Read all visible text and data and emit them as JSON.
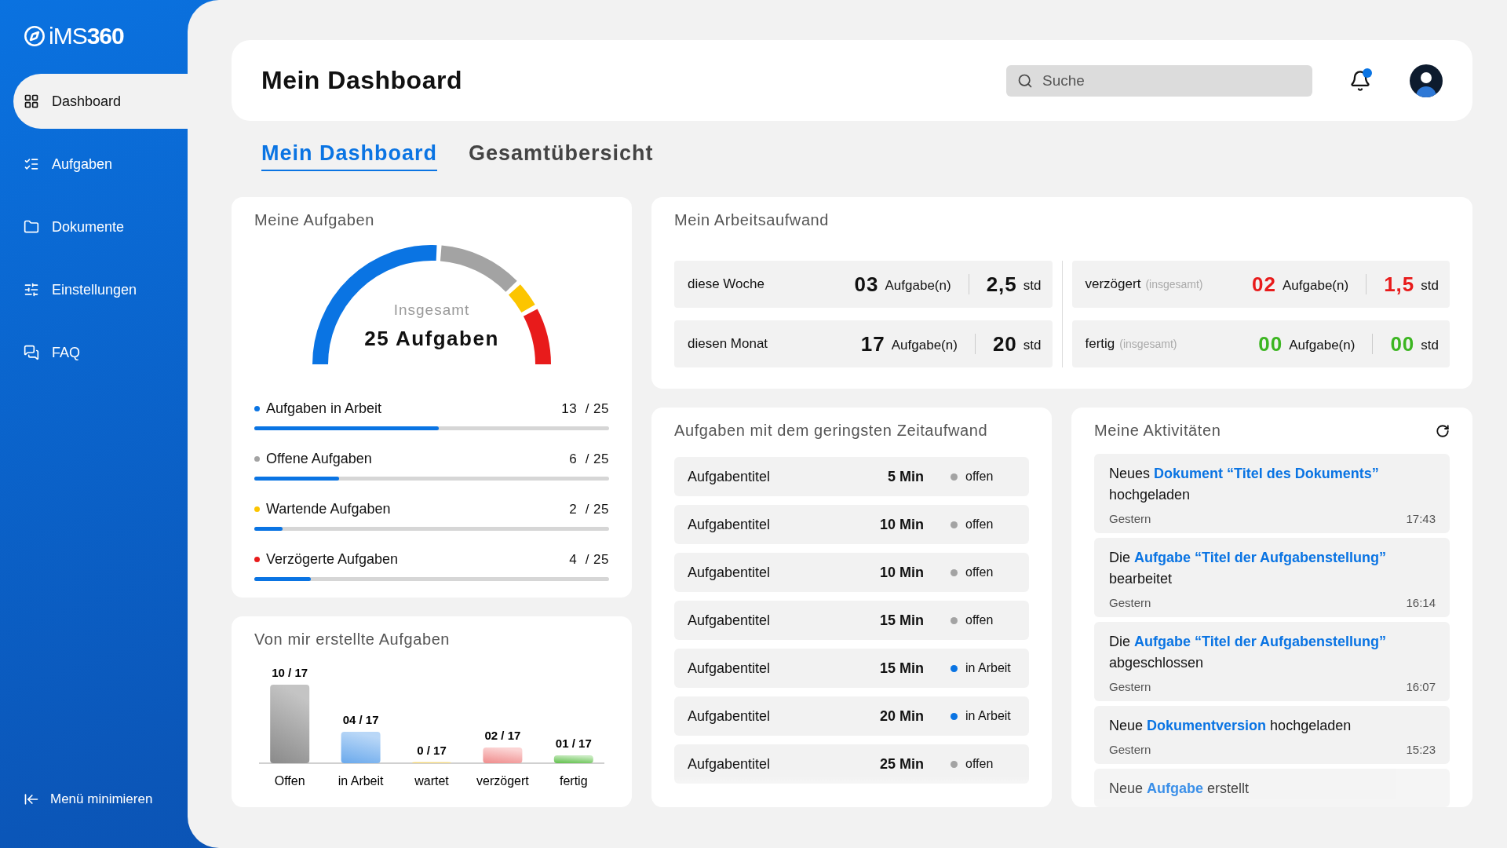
{
  "sidebar": {
    "logo": "iMS**360**",
    "items": [
      {
        "label": "Dashboard",
        "selected": true
      },
      {
        "label": "Aufgaben",
        "selected": false
      },
      {
        "label": "Dokumente",
        "selected": false
      },
      {
        "label": "Einstellungen",
        "selected": false
      },
      {
        "label": "FAQ",
        "selected": false
      }
    ],
    "collapse": "Menü minimieren"
  },
  "header": {
    "title": "Mein Dashboard",
    "search": {
      "placeholder": "Suche"
    },
    "notifications": {
      "unread": true
    }
  },
  "tabs": [
    {
      "label": "Mein Dashboard",
      "selected": true
    },
    {
      "label": "Gesamtübersicht",
      "selected": false
    }
  ],
  "my_tasks": {
    "title": "Meine Aufgaben",
    "gauge_caption": "Insgesamt",
    "gauge_total": "25 Aufgaben",
    "items": [
      {
        "label": "Aufgaben in Arbeit",
        "count": "13",
        "total": "/ 25",
        "color": "#0a74e3",
        "level": 0.52
      },
      {
        "label": "Offene Aufgaben",
        "count": "6",
        "total": "/ 25",
        "color": "#a3a3a3",
        "level": 0.24
      },
      {
        "label": "Wartende Aufgaben",
        "count": "2",
        "total": "/ 25",
        "color": "#fcc500",
        "level": 0.08
      },
      {
        "label": "Verzögerte Aufgaben",
        "count": "4",
        "total": "/ 25",
        "color": "#e81b1b",
        "level": 0.16
      }
    ]
  },
  "workload": {
    "title": "Mein Arbeitsaufwand",
    "columns": [
      [
        {
          "label": "diese Woche",
          "count": "03",
          "count_unit": "Aufgabe(n)",
          "hours": "2,5",
          "hours_unit": "std",
          "color": "#111111"
        },
        {
          "label": "diesen Monat",
          "count": "17",
          "count_unit": "Aufgabe(n)",
          "hours": "20",
          "hours_unit": "std",
          "color": "#111111"
        }
      ],
      [
        {
          "label": "verzögert",
          "note": "(insgesamt)",
          "count": "02",
          "count_unit": "Aufgabe(n)",
          "hours": "1,5",
          "hours_unit": "std",
          "color": "#e81b1b"
        },
        {
          "label": "fertig",
          "note": "(insgesamt)",
          "count": "00",
          "count_unit": "Aufgabe(n)",
          "hours": "00",
          "hours_unit": "std",
          "color": "#3cb521"
        }
      ]
    ]
  },
  "created_tasks": {
    "title": "Von mir erstellte Aufgaben",
    "chart_data": {
      "type": "bar",
      "categories": [
        "Offen",
        "in Arbeit",
        "wartet",
        "verzögert",
        "fertig"
      ],
      "values": [
        10,
        4,
        0,
        2,
        1
      ],
      "value_labels": [
        "10 / 17",
        "04 / 17",
        "0 / 17",
        "02 / 17",
        "01 / 17"
      ]
    }
  },
  "quick_tasks": {
    "title": "Aufgaben mit dem geringsten Zeitaufwand",
    "rows": [
      {
        "title": "Aufgabentitel",
        "duration": "5 Min",
        "status": "offen",
        "color": "#a3a3a3"
      },
      {
        "title": "Aufgabentitel",
        "duration": "10 Min",
        "status": "offen",
        "color": "#a3a3a3"
      },
      {
        "title": "Aufgabentitel",
        "duration": "10 Min",
        "status": "offen",
        "color": "#a3a3a3"
      },
      {
        "title": "Aufgabentitel",
        "duration": "15 Min",
        "status": "offen",
        "color": "#a3a3a3"
      },
      {
        "title": "Aufgabentitel",
        "duration": "15 Min",
        "status": "in Arbeit",
        "color": "#0a74e3"
      },
      {
        "title": "Aufgabentitel",
        "duration": "20 Min",
        "status": "in Arbeit",
        "color": "#0a74e3"
      },
      {
        "title": "Aufgabentitel",
        "duration": "25 Min",
        "status": "offen",
        "color": "#a3a3a3"
      }
    ]
  },
  "activities": {
    "title": "Meine Aktivitäten",
    "items": [
      {
        "before": "Neues",
        "link": "Dokument “Titel des Dokuments”",
        "after": "hochgeladen",
        "day": "Gestern",
        "time": "17:43",
        "faded": false
      },
      {
        "before": "Die",
        "link": "Aufgabe “Titel der Aufgabenstellung”",
        "after": "bearbeitet",
        "day": "Gestern",
        "time": "16:14",
        "faded": false
      },
      {
        "before": "Die",
        "link": "Aufgabe “Titel der Aufgabenstellung”",
        "after": "abgeschlossen",
        "day": "Gestern",
        "time": "16:07",
        "faded": false
      },
      {
        "before": "Neue",
        "link": "Dokumentversion",
        "after": "hochgeladen",
        "day": "Gestern",
        "time": "15:23",
        "faded": false
      },
      {
        "before": "Neue",
        "link": "Aufgabe",
        "after": "erstellt",
        "faded": true
      }
    ]
  }
}
